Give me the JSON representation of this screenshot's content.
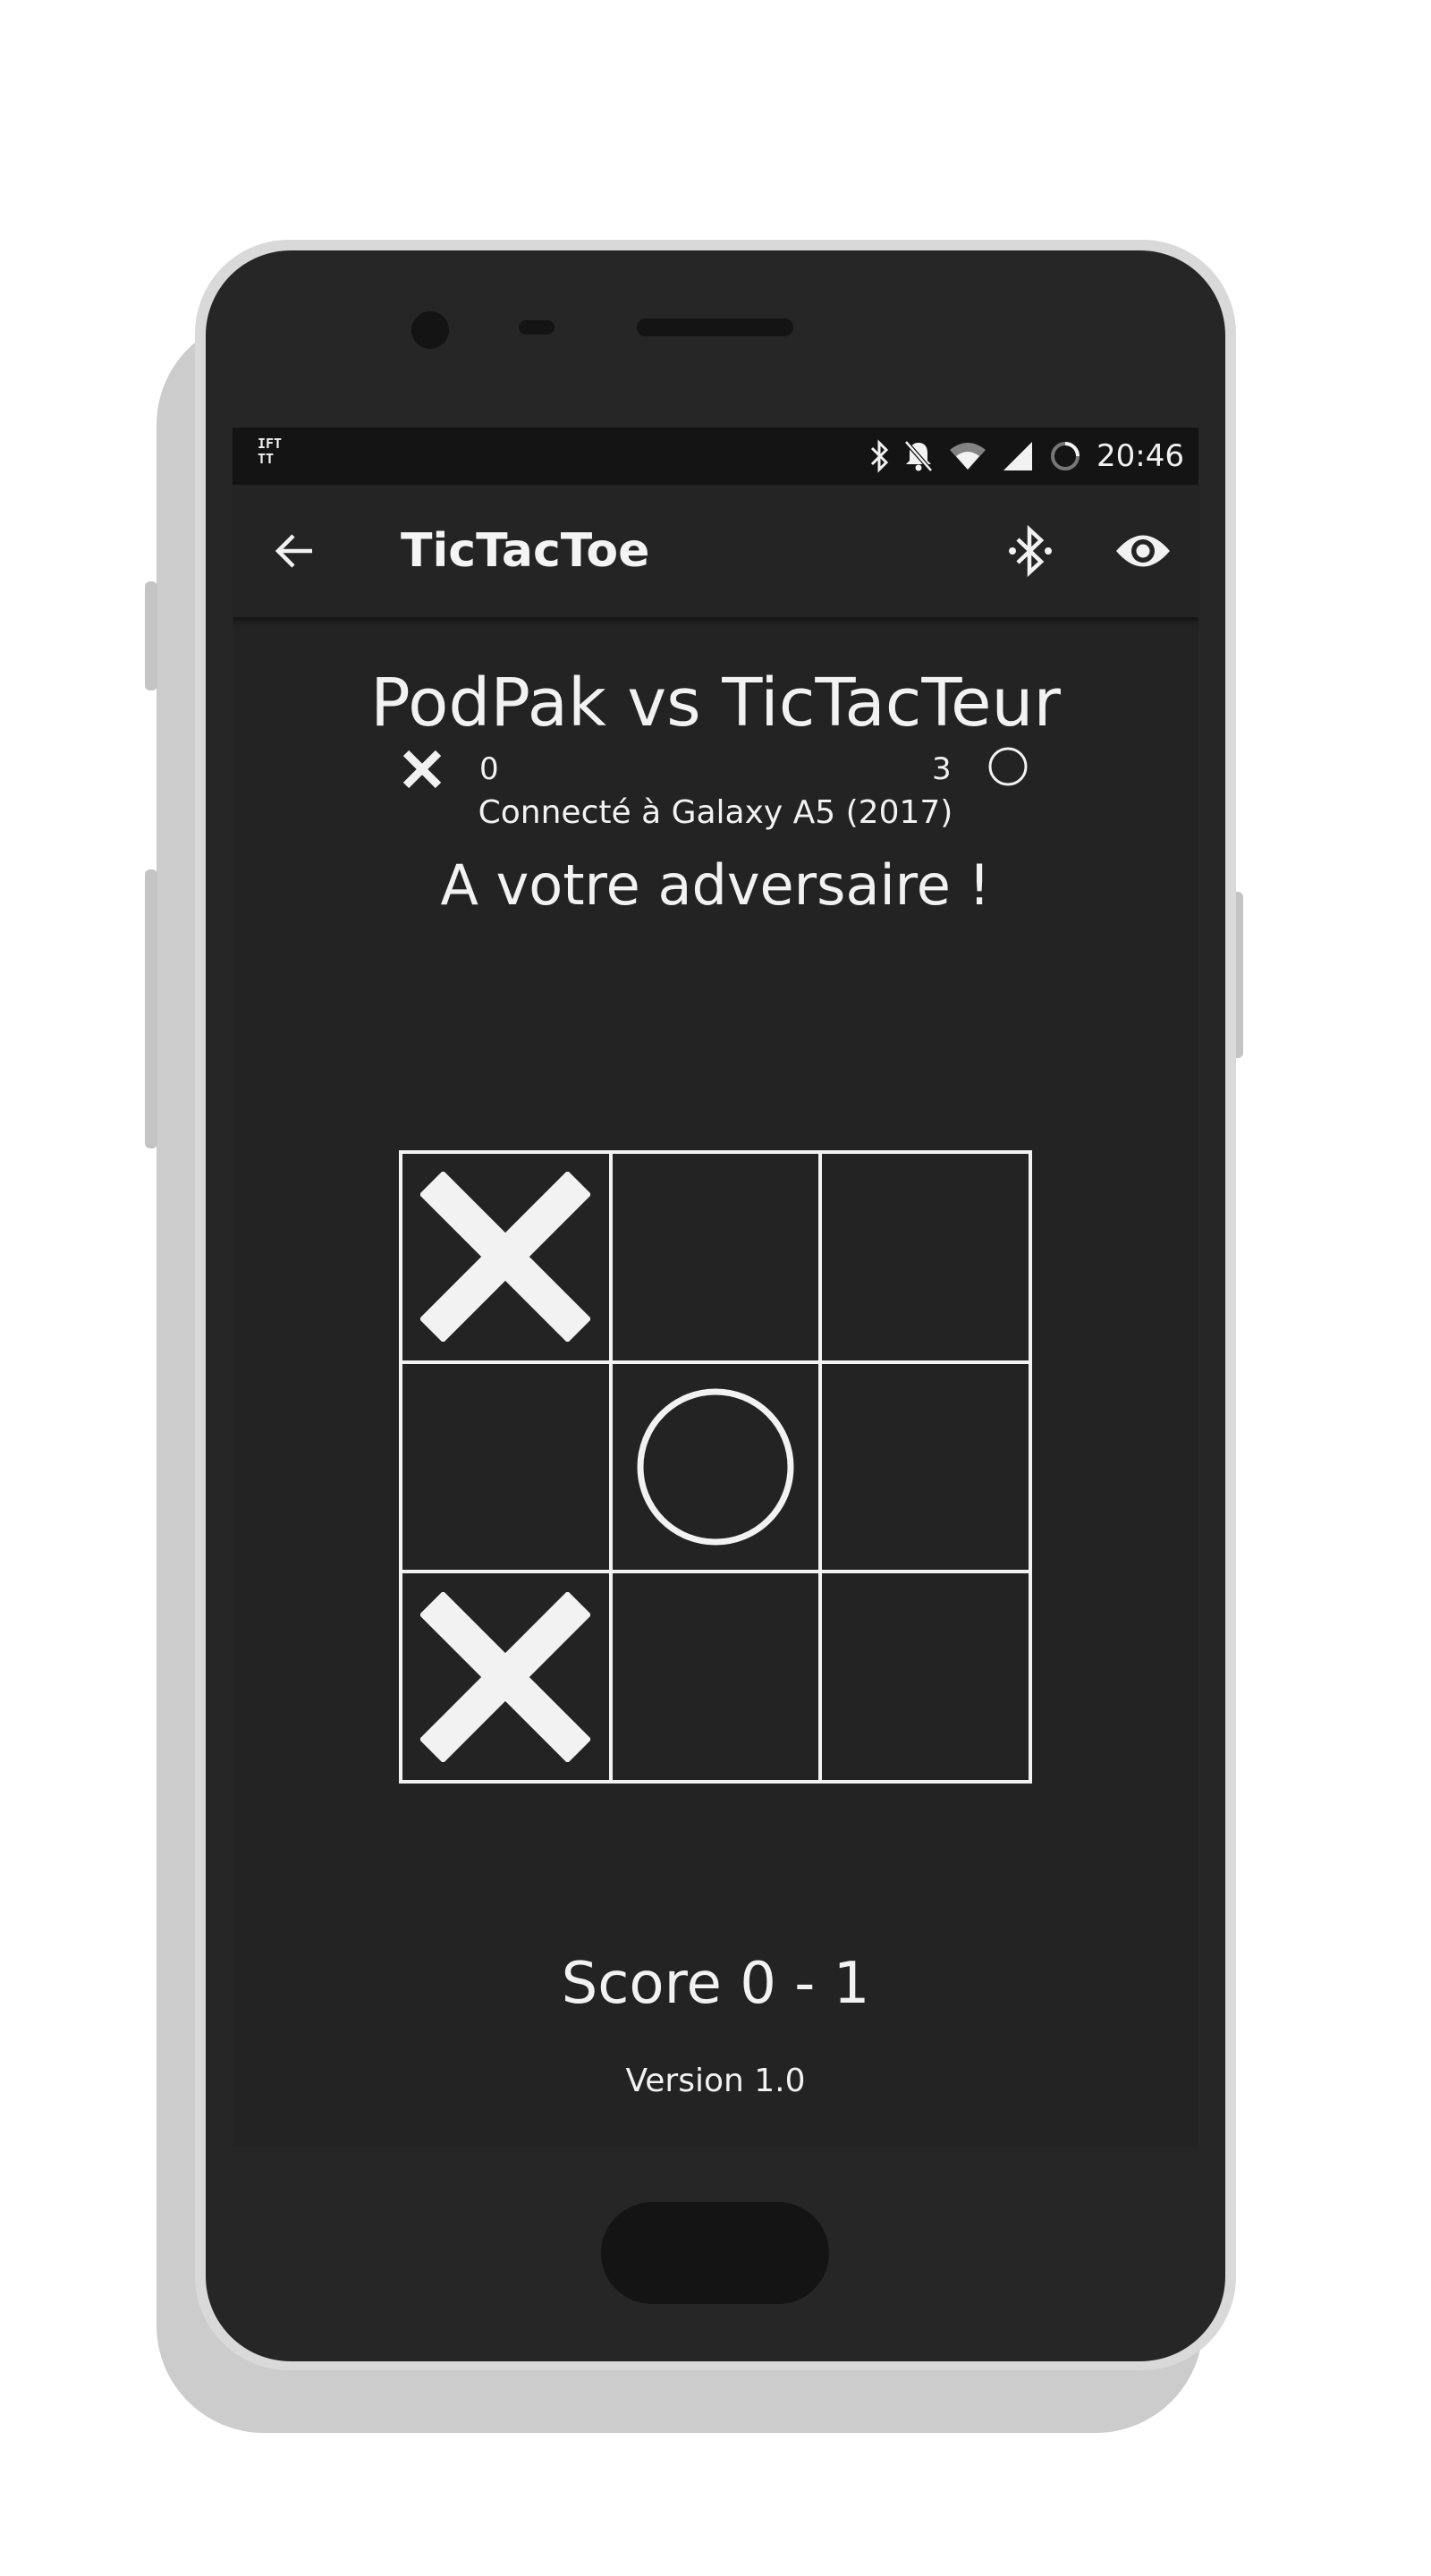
{
  "status_bar": {
    "notification_text": "IFTTT",
    "time": "20:46"
  },
  "app_bar": {
    "title": "TicTacToe",
    "icons": [
      "arrow-back-icon",
      "bluetooth-searching-icon",
      "eye-icon"
    ]
  },
  "game": {
    "match_title": "PodPak vs TicTacTeur",
    "player1": {
      "mark": "X",
      "score": "0"
    },
    "player2": {
      "mark": "O",
      "score": "3"
    },
    "connection": "Connecté à Galaxy A5 (2017)",
    "turn_message": "A votre adversaire !",
    "board": [
      "X",
      "",
      "",
      "",
      "O",
      "",
      "X",
      "",
      ""
    ]
  },
  "footer": {
    "score": "Score 0 - 1",
    "version": "Version 1.0"
  },
  "colors": {
    "background": "#232323",
    "status_bar": "#141414",
    "foreground": "#f2f2f2"
  }
}
